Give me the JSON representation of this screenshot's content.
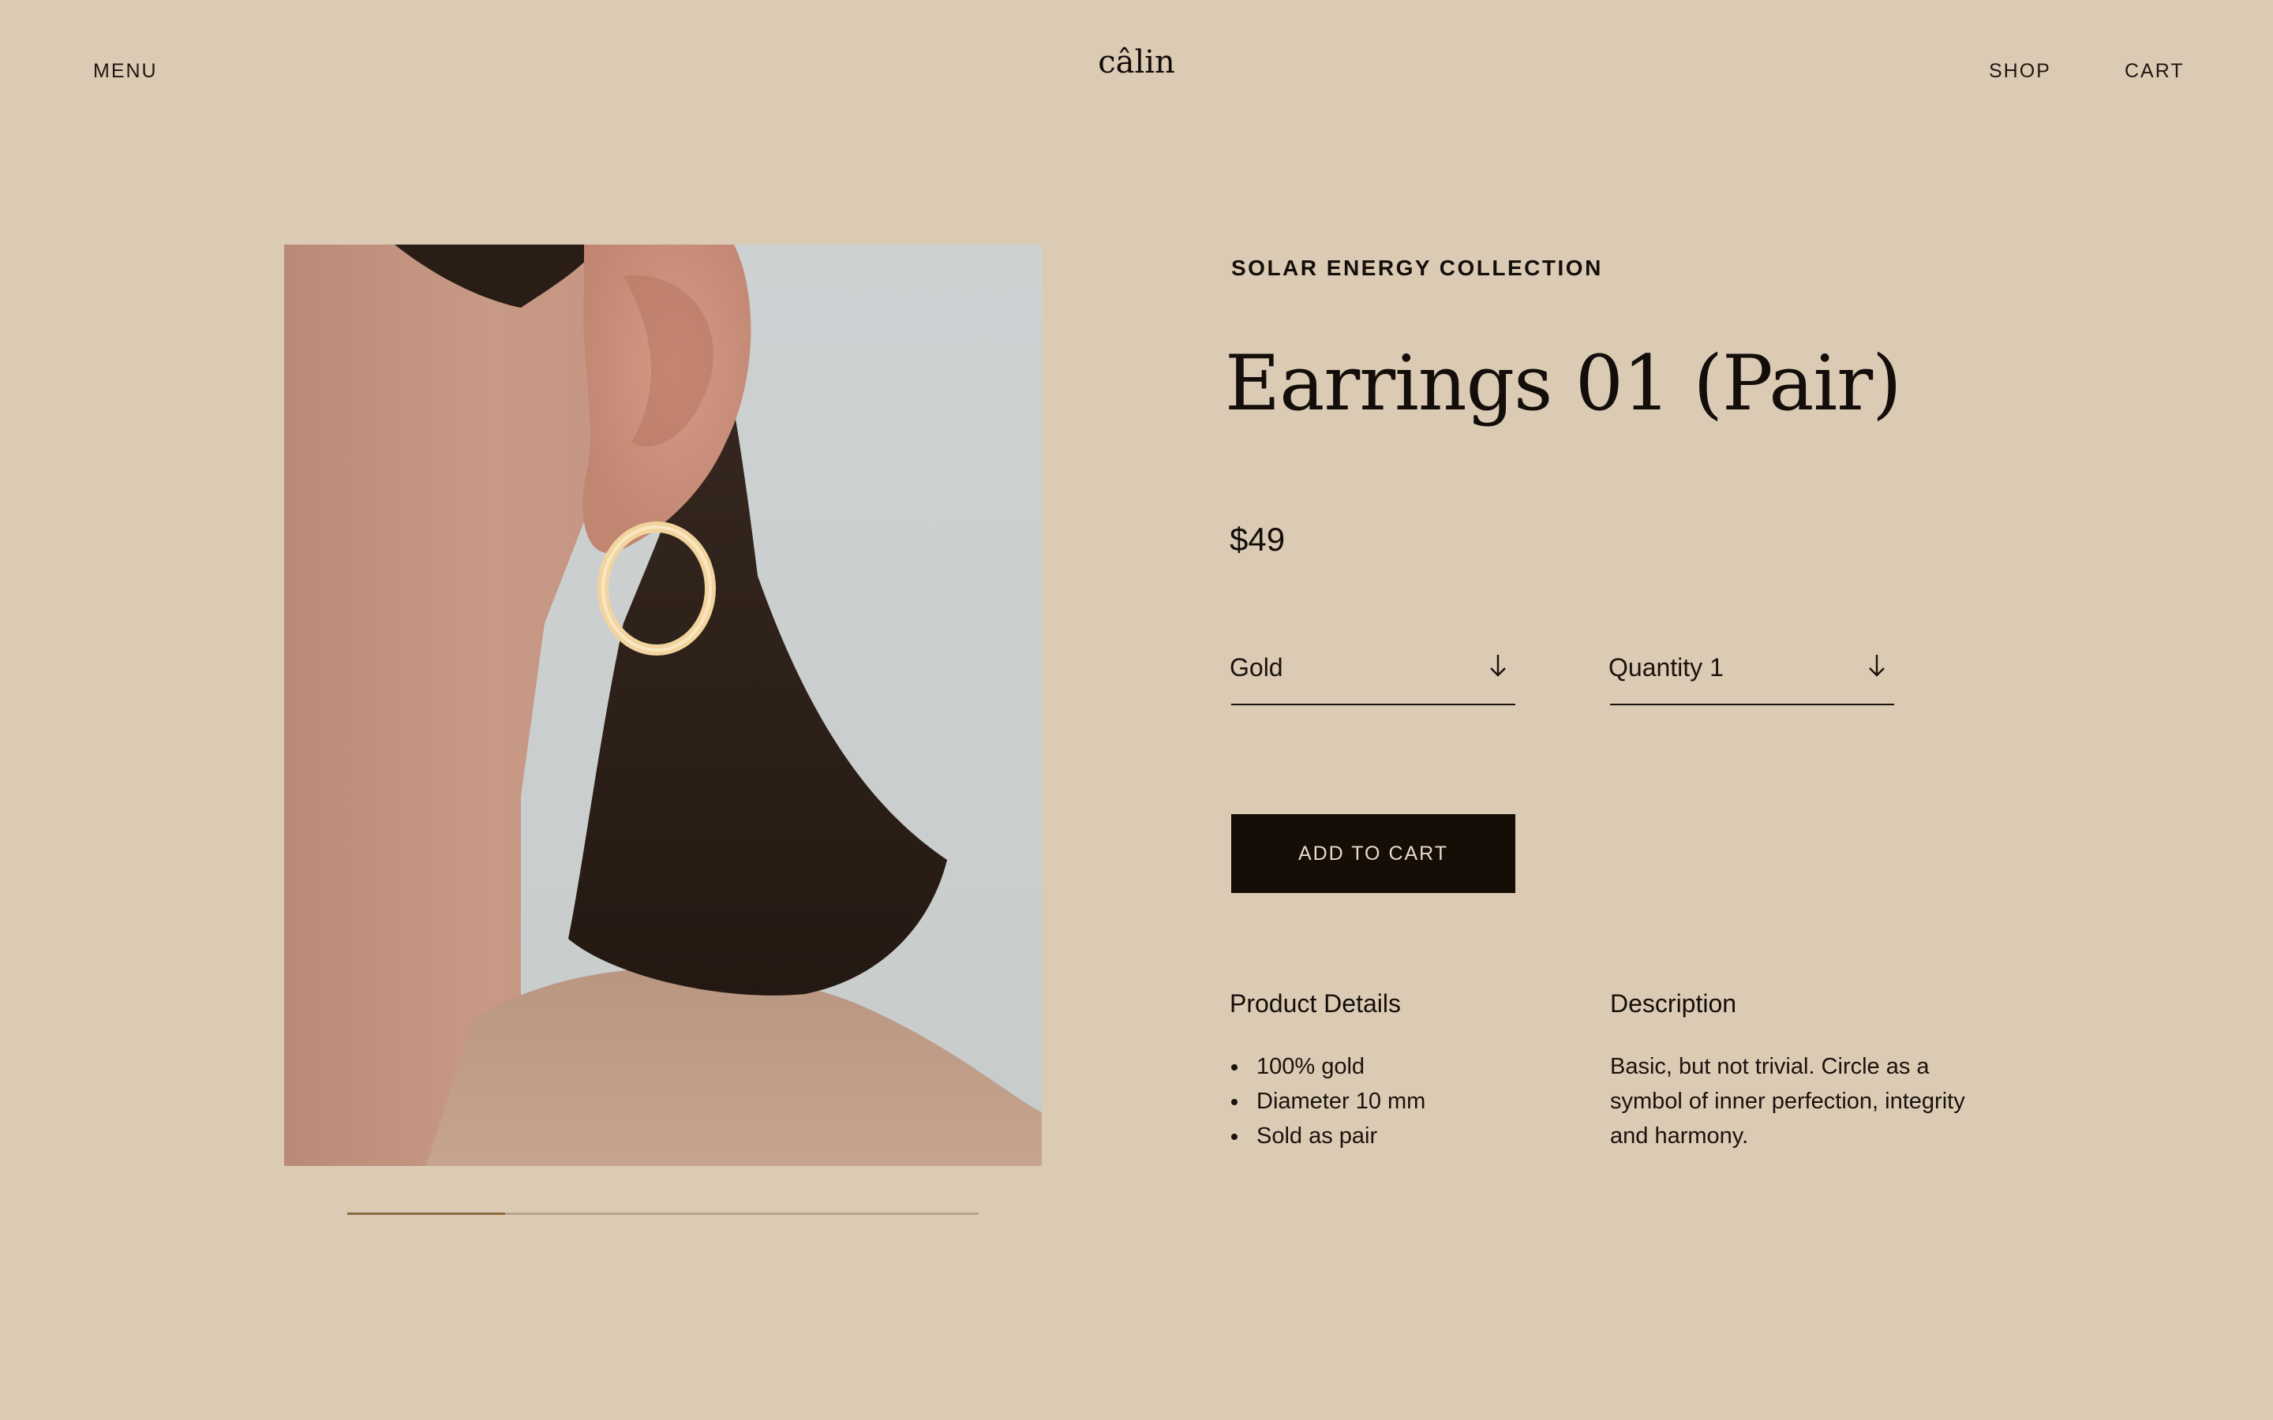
{
  "header": {
    "menu_label": "MENU",
    "logo": "câlin",
    "shop_label": "SHOP",
    "cart_label": "CART"
  },
  "gallery": {
    "image_subject": "ear-with-gold-circle-earring",
    "progress": 0.25
  },
  "product": {
    "collection": "SOLAR ENERGY COLLECTION",
    "title": "Earrings 01 (Pair)",
    "price": "$49",
    "material_select": {
      "value": "Gold",
      "icon": "arrow-down-icon"
    },
    "quantity_select": {
      "value": "Quantity 1",
      "icon": "arrow-down-icon"
    },
    "add_to_cart_label": "ADD TO CART"
  },
  "details": {
    "heading": "Product Details",
    "items": [
      "100% gold",
      "Diameter 10 mm",
      "Sold as pair"
    ]
  },
  "description": {
    "heading": "Description",
    "text": "Basic, but not trivial. Circle as a symbol of inner perfection, integrity and harmony."
  },
  "colors": {
    "background": "#dbcbb5",
    "text": "#140e0a",
    "button": "#150d06",
    "progress_fill": "#8c6a40",
    "earring_gold": "#f2d49e"
  }
}
